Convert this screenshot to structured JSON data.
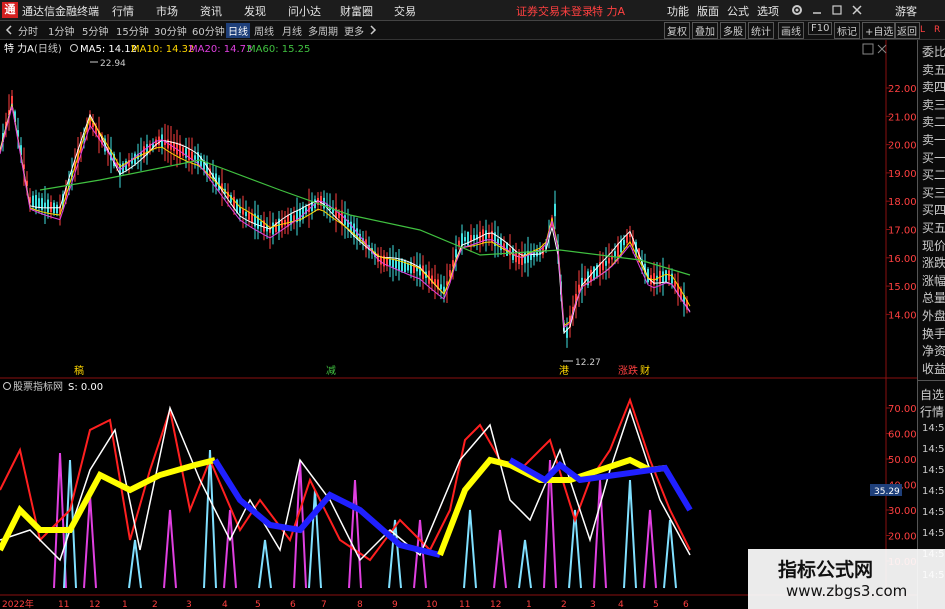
{
  "app": {
    "logo_glyph": "通",
    "title": "通达信金融终端",
    "menu": [
      "行情",
      "市场",
      "资讯",
      "发现",
      "问小达",
      "财富圈",
      "交易"
    ],
    "login_status": "证券交易未登录",
    "stock_short": "特 力A",
    "right_menu": [
      "功能",
      "版面",
      "公式",
      "选项"
    ],
    "user": "游客",
    "window_icons": [
      "gear-icon",
      "minimize-icon",
      "maximize-icon",
      "close-icon"
    ]
  },
  "periods": {
    "items": [
      "分时",
      "1分钟",
      "5分钟",
      "15分钟",
      "30分钟",
      "60分钟",
      "日线",
      "周线",
      "月线",
      "多周期",
      "更多"
    ],
    "active": "日线",
    "right_buttons": [
      "复权",
      "叠加",
      "多股",
      "统计",
      "画线",
      "F10",
      "标记",
      "+自选",
      "返回"
    ]
  },
  "legend": {
    "name": "特 力A",
    "period": "(日线)",
    "ma5": "MA5: 14.12",
    "ma10": "MA10: 14.32",
    "ma20": "MA20: 14.73",
    "ma60": "MA60: 15.25",
    "colors": {
      "ma5": "#ffffff",
      "ma10": "#ffd700",
      "ma20": "#e040e0",
      "ma60": "#40c040"
    }
  },
  "main_axis": {
    "ticks": [
      "22.00",
      "21.00",
      "20.00",
      "19.00",
      "18.00",
      "17.00",
      "16.00",
      "15.00",
      "14.00"
    ]
  },
  "annotations": {
    "high": "22.94",
    "low": "12.27",
    "markers": [
      {
        "text": "稿",
        "color": "#ffd700"
      },
      {
        "text": "减",
        "color": "#40c040"
      },
      {
        "text": "港",
        "color": "#ffd700"
      },
      {
        "text": "涨跌",
        "color": "#ff4040"
      },
      {
        "text": "财",
        "color": "#ffd700"
      }
    ]
  },
  "indicator": {
    "name": "股票指标网",
    "value": "S: 0.00",
    "ticks": [
      "70.00",
      "60.00",
      "50.00",
      "40.00",
      "30.00",
      "20.00",
      "10.00"
    ],
    "current": "35.29",
    "colors": {
      "red": "#ff2020",
      "white": "#ffffff",
      "yellow": "#ffff00",
      "blue": "#2020ff",
      "magenta": "#e040e0",
      "cyan": "#80e0ff"
    }
  },
  "x_axis": {
    "labels": [
      "2022年",
      "11",
      "12",
      "1",
      "2",
      "3",
      "4",
      "5",
      "6",
      "7",
      "8",
      "9",
      "10",
      "11",
      "12",
      "1",
      "2",
      "3",
      "4",
      "5",
      "6"
    ]
  },
  "side_panel": {
    "top_labels": [
      "L",
      "R"
    ],
    "quote_items": [
      "委比",
      "卖五",
      "卖四",
      "卖三",
      "卖二",
      "卖一",
      "买一",
      "买二",
      "买三",
      "买四",
      "买五",
      "现价",
      "涨跌",
      "涨幅",
      "总量",
      "外盘",
      "换手",
      "净资",
      "收益"
    ],
    "bottom_items": [
      "自选",
      "行情"
    ],
    "times": [
      "14:5",
      "14:5",
      "14:5",
      "14:5",
      "14:5",
      "14:5",
      "14:5",
      "14:5"
    ]
  },
  "watermark": {
    "title": "指标公式网",
    "url": "www.zbgs3.com"
  }
}
